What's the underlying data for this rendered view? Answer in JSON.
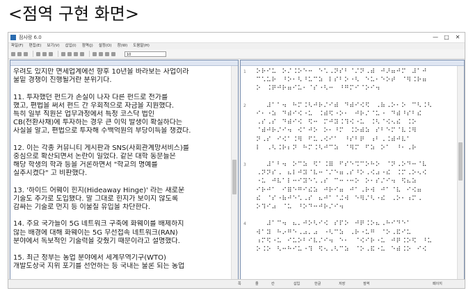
{
  "caption": "<점역 구현 화면>",
  "window": {
    "title": "점사랑 6.0",
    "controls": [
      "—",
      "□",
      "✕"
    ]
  },
  "menu": [
    "파일(F)",
    "편집(E)",
    "보기(V)",
    "삽입(I)",
    "점역(J)",
    "설정(O)",
    "창(W)",
    "도움말(H)"
  ],
  "toolbar": {
    "select_value": "10"
  },
  "left_pane": {
    "lines": [
      "우려도 있지만 면세업계에선 향후 10년을 바라보는 사업이라",
      "물밑 경쟁이 진행될거란 분위기다.",
      "",
      "   11. 투자했던 펀드가 손실이 나자 다른 펀드로 전가를",
      "했고, 편법을 써서 펀드 간 우회적으로 자금을 지원했다.",
      "특히 일부 직원은 업무과정에서 특정 코스닥 법인",
      "CB(전환사채)에 투자하는 경우 큰 이익 발생이 확실하다는",
      "사실을 알고, 편법으로 투자해 수백억원의 부당이득을 챙겼다.",
      "",
      "   12. 이는 각종 커뮤니티 게시판과 SNS(사회관계망서비스)를",
      "중심으로 확산되면서 논란이 일었다. 같은 대학 동문들은",
      "해당 학생의 학과 등을 거론하면서 \"학교의 명예를",
      "실추시켰다\" 고 비판했다.",
      "",
      "   13. '하이드 어웨이 힌지(Hideaway Hinge)' 라는 새로운",
      "기술도 추가로 도입됐다. 말 그대로 힌지가 보이지 않도록",
      "감싸는 기술로 먼지 등 이물질 유입을 차단한다.",
      "",
      "   14. 주요 국가들이 5G 네트워크 구축에 화웨이를 배제하지",
      "않는 배경에 대해 화웨이는 5G 무선접속 네트워크(RAN)",
      "분야에서 독보적인 기술력을 갖췄기 때문이라고 설명했다.",
      "",
      "   15. 최근 정부는 농업 분야에서 세계무역기구(WTO)",
      "개발도상국 지위 포기를 선언하는 등 국내는 물론 되는 농업"
    ]
  },
  "right_pane": {
    "lines": [
      "⠕⠗⠊⠥⠀⠕⠌⠨⠕⠑⠒⠀⠑⠡⠠⠝⠎⠃⠈⠌⠝⠠⠾⠀⠚⠜⠶⠚⠍⠀⠼⠁⠚",
      "⠉⠡⠥⠗⠀⠘⠕⠂⠣⠘⠥⠉⠵⠀⠇⠎⠃⠕⠐⠣⠀⠑⠥⠂⠑⠕⠞⠀⠈⠻⠨⠗⠶",
      "⠕⠀⠨⠟⠚⠗⠶⠊⠥⠂⠈⠎⠐⠣⠒⠀⠘⠛⠍⠊⠈⠕⠊⠲",
      "",
      "⠀⠀⠼⠁⠁⠲⠀⠓⠍⠨⠣⠚⠗⠌⠊⠾⠀⠙⠾⠊⠪⠫⠀⠠⠷⠠⠕⠂⠕⠀⠉⠣⠨⠣",
      "⠊⠂⠐⠵⠀⠙⠾⠊⠪⠐⠥⠀⠨⠾⠫⠐⠕⠂⠀⠚⠗⠌⠈⠥⠐⠀⠙⠾⠘⠎⠃⠮",
      "⠠⠎⠠⠎⠀⠙⠾⠊⠪⠀⠫⠒⠀⠍⠚⠽⠨⠹⠪⠐⠥⠀⠨⠣⠈⠪⠢⠮⠀⠨⠕",
      "⠈⠾⠚⠗⠌⠊⠲⠀⠪⠁⠚⠕⠀⠕⠂⠘⠍⠀⠨⠕⠾⠵⠀⠎⠃⠑⠍⠈⠧⠨⠻",
      "⠝⠠⠎⠀⠊⠪⠁⠨⠻⠀⠋⠥⠠⠪⠊⠁⠀⠘⠎⠃⠟⠀⠰⠃⠠⠨⠾⠚⠧⠁",
      "⠇⠀⠠⠣⠨⠗⠆⠝⠀⠓⠍⠨⠣⠚⠉⠵⠀⠈⠻⠍⠀⠋⠵⠀⠕⠁⠀⠘⠂⠠⠗",
      "",
      "⠀⠀⠼⠁⠃⠲⠀⠕⠉⠵⠀⠫⠁⠨⠿⠀⠋⠎⠑⠩⠉⠕⠓⠕⠀⠈⠝⠠⠕⠙⠒⠈⠧",
      "⠠⠝⠝⠎⠠⠀⠦⠇⠚⠽⠈⠧⠒⠈⠌⠑⠶⠠⠎⠘⠕⠠⠪⠴⠐⠮⠀⠨⠍⠠⠕⠢⠪",
      "⠐⠥⠀⠚⠧⠁⠇⠒⠊⠽⠑⠡⠠⠎⠀⠉⠒⠐⠒⠕⠀⠕⠂⠎⠌⠊⠲⠀⠫⠦⠵",
      "⠊⠗⠚⠁⠀⠊⠿⠑⠛⠊⠮⠵⠀⠚⠗⠊⠶⠀⠚⠁⠠⠗⠺⠀⠚⠁⠈⠧⠀⠊⠪⠶",
      "⠮⠀⠈⠎⠐⠷⠚⠑⠡⠠⠎⠀⠦⠚⠁⠈⠬⠺⠀⠑⠻⠌⠣⠐⠮⠀⠠⠕⠂⠰⠍⠠",
      "⠕⠹⠊⠴⠀⠈⠥⠀⠘⠕⠙⠒⠚⠗⠌⠊⠲",
      "",
      "⠀⠀⠼⠁⠉⠲⠀⠦⠄⠚⠕⠣⠊⠪⠀⠎⠏⠕⠀⠚⠟⠨⠕⠦⠠⠓⠊⠙⠑⠁",
      "⠺⠁⠽⠀⠓⠔⠛⠑⠠⠴⠄⠴⠀⠐⠣⠉⠵⠀⠠⠗⠐⠥⠛⠀⠈⠕⠠⠯⠊⠥",
      "⠰⠍⠫⠐⠥⠀⠊⠥⠕⠃⠊⠧⠌⠊⠲⠀⠑⠂⠀⠈⠪⠊⠗⠐⠥⠀⠚⠟⠨⠕⠫⠀⠘⠥",
      "⠕⠨⠕⠀⠣⠒⠓⠊⠥⠐⠹⠀⠫⠢⠠⠣⠉⠵⠀⠈⠕⠠⠯⠐⠥⠀⠑⠾⠨⠕⠀⠊⠪"
    ],
    "marks": [
      "1",
      "",
      "",
      "",
      "2",
      "",
      "",
      "",
      "",
      "",
      "",
      "3",
      "",
      "",
      "",
      "",
      "",
      "",
      "4",
      "",
      "",
      ""
    ]
  },
  "status": [
    "쪽",
    "줄",
    "칸",
    "삽입",
    "한글",
    "저장",
    "점역",
    "페이지"
  ]
}
